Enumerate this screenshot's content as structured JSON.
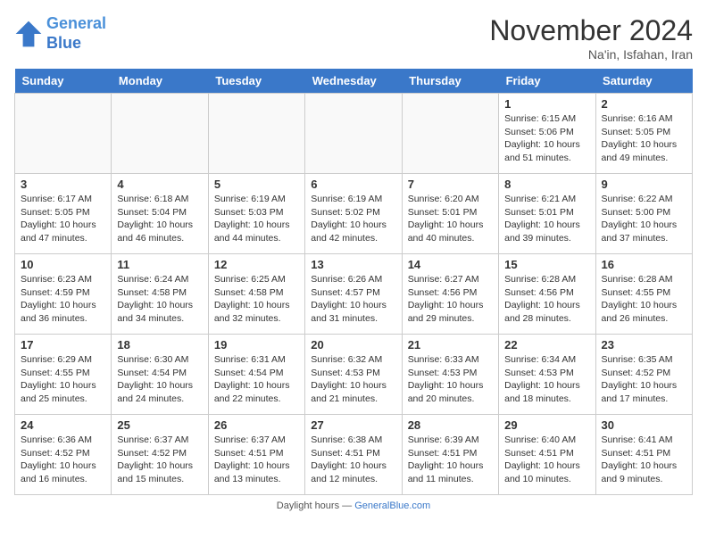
{
  "header": {
    "logo_line1": "General",
    "logo_line2": "Blue",
    "month_title": "November 2024",
    "location": "Na'in, Isfahan, Iran"
  },
  "days_of_week": [
    "Sunday",
    "Monday",
    "Tuesday",
    "Wednesday",
    "Thursday",
    "Friday",
    "Saturday"
  ],
  "weeks": [
    [
      {
        "day": "",
        "info": ""
      },
      {
        "day": "",
        "info": ""
      },
      {
        "day": "",
        "info": ""
      },
      {
        "day": "",
        "info": ""
      },
      {
        "day": "",
        "info": ""
      },
      {
        "day": "1",
        "info": "Sunrise: 6:15 AM\nSunset: 5:06 PM\nDaylight: 10 hours and 51 minutes."
      },
      {
        "day": "2",
        "info": "Sunrise: 6:16 AM\nSunset: 5:05 PM\nDaylight: 10 hours and 49 minutes."
      }
    ],
    [
      {
        "day": "3",
        "info": "Sunrise: 6:17 AM\nSunset: 5:05 PM\nDaylight: 10 hours and 47 minutes."
      },
      {
        "day": "4",
        "info": "Sunrise: 6:18 AM\nSunset: 5:04 PM\nDaylight: 10 hours and 46 minutes."
      },
      {
        "day": "5",
        "info": "Sunrise: 6:19 AM\nSunset: 5:03 PM\nDaylight: 10 hours and 44 minutes."
      },
      {
        "day": "6",
        "info": "Sunrise: 6:19 AM\nSunset: 5:02 PM\nDaylight: 10 hours and 42 minutes."
      },
      {
        "day": "7",
        "info": "Sunrise: 6:20 AM\nSunset: 5:01 PM\nDaylight: 10 hours and 40 minutes."
      },
      {
        "day": "8",
        "info": "Sunrise: 6:21 AM\nSunset: 5:01 PM\nDaylight: 10 hours and 39 minutes."
      },
      {
        "day": "9",
        "info": "Sunrise: 6:22 AM\nSunset: 5:00 PM\nDaylight: 10 hours and 37 minutes."
      }
    ],
    [
      {
        "day": "10",
        "info": "Sunrise: 6:23 AM\nSunset: 4:59 PM\nDaylight: 10 hours and 36 minutes."
      },
      {
        "day": "11",
        "info": "Sunrise: 6:24 AM\nSunset: 4:58 PM\nDaylight: 10 hours and 34 minutes."
      },
      {
        "day": "12",
        "info": "Sunrise: 6:25 AM\nSunset: 4:58 PM\nDaylight: 10 hours and 32 minutes."
      },
      {
        "day": "13",
        "info": "Sunrise: 6:26 AM\nSunset: 4:57 PM\nDaylight: 10 hours and 31 minutes."
      },
      {
        "day": "14",
        "info": "Sunrise: 6:27 AM\nSunset: 4:56 PM\nDaylight: 10 hours and 29 minutes."
      },
      {
        "day": "15",
        "info": "Sunrise: 6:28 AM\nSunset: 4:56 PM\nDaylight: 10 hours and 28 minutes."
      },
      {
        "day": "16",
        "info": "Sunrise: 6:28 AM\nSunset: 4:55 PM\nDaylight: 10 hours and 26 minutes."
      }
    ],
    [
      {
        "day": "17",
        "info": "Sunrise: 6:29 AM\nSunset: 4:55 PM\nDaylight: 10 hours and 25 minutes."
      },
      {
        "day": "18",
        "info": "Sunrise: 6:30 AM\nSunset: 4:54 PM\nDaylight: 10 hours and 24 minutes."
      },
      {
        "day": "19",
        "info": "Sunrise: 6:31 AM\nSunset: 4:54 PM\nDaylight: 10 hours and 22 minutes."
      },
      {
        "day": "20",
        "info": "Sunrise: 6:32 AM\nSunset: 4:53 PM\nDaylight: 10 hours and 21 minutes."
      },
      {
        "day": "21",
        "info": "Sunrise: 6:33 AM\nSunset: 4:53 PM\nDaylight: 10 hours and 20 minutes."
      },
      {
        "day": "22",
        "info": "Sunrise: 6:34 AM\nSunset: 4:53 PM\nDaylight: 10 hours and 18 minutes."
      },
      {
        "day": "23",
        "info": "Sunrise: 6:35 AM\nSunset: 4:52 PM\nDaylight: 10 hours and 17 minutes."
      }
    ],
    [
      {
        "day": "24",
        "info": "Sunrise: 6:36 AM\nSunset: 4:52 PM\nDaylight: 10 hours and 16 minutes."
      },
      {
        "day": "25",
        "info": "Sunrise: 6:37 AM\nSunset: 4:52 PM\nDaylight: 10 hours and 15 minutes."
      },
      {
        "day": "26",
        "info": "Sunrise: 6:37 AM\nSunset: 4:51 PM\nDaylight: 10 hours and 13 minutes."
      },
      {
        "day": "27",
        "info": "Sunrise: 6:38 AM\nSunset: 4:51 PM\nDaylight: 10 hours and 12 minutes."
      },
      {
        "day": "28",
        "info": "Sunrise: 6:39 AM\nSunset: 4:51 PM\nDaylight: 10 hours and 11 minutes."
      },
      {
        "day": "29",
        "info": "Sunrise: 6:40 AM\nSunset: 4:51 PM\nDaylight: 10 hours and 10 minutes."
      },
      {
        "day": "30",
        "info": "Sunrise: 6:41 AM\nSunset: 4:51 PM\nDaylight: 10 hours and 9 minutes."
      }
    ]
  ],
  "footer": {
    "text": "Daylight hours",
    "link": "GeneralBlue.com"
  }
}
